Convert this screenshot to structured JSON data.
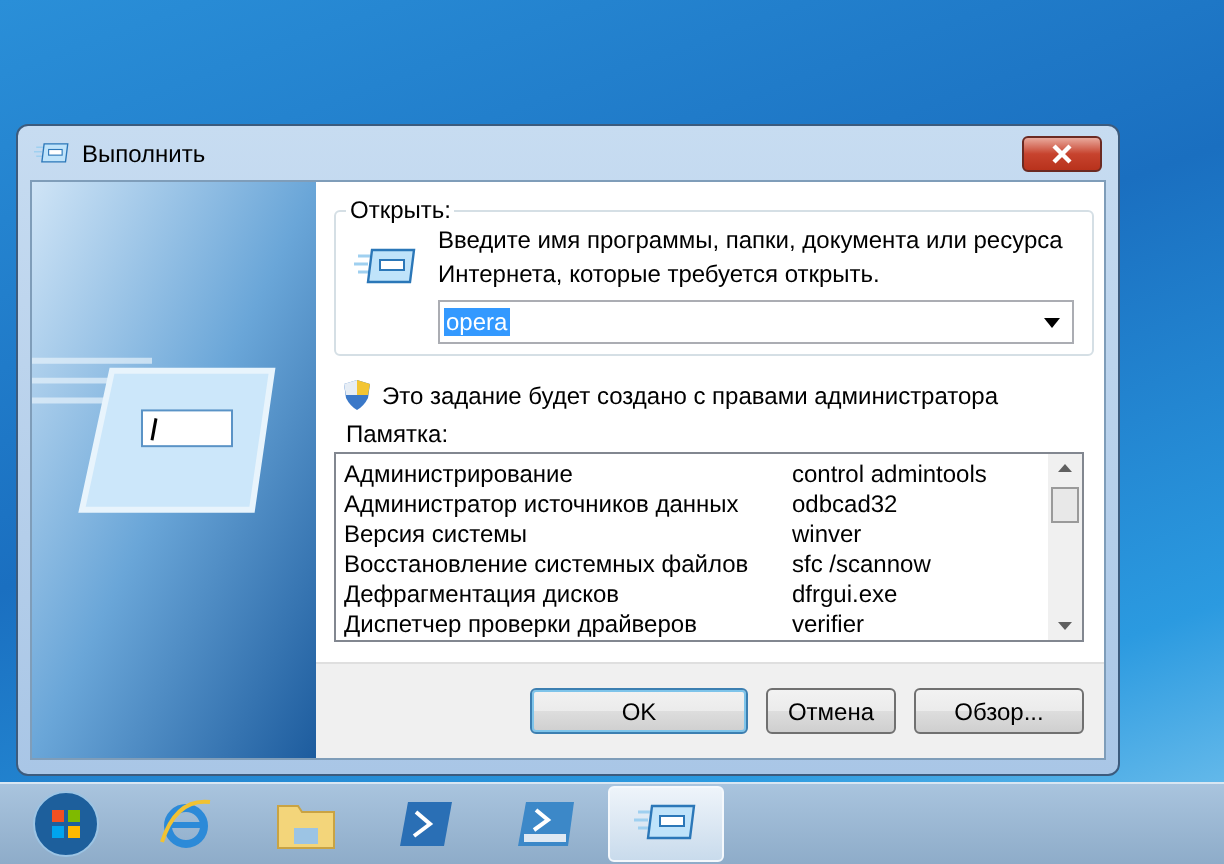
{
  "window": {
    "title": "Выполнить"
  },
  "open_group": {
    "label": "Открыть:",
    "description": "Введите имя программы, папки, документа или ресурса Интернета, которые требуется открыть.",
    "input": {
      "value": "opera",
      "selected": true
    }
  },
  "admin_note": "Это задание будет создано с правами администратора",
  "memo": {
    "label": "Памятка:",
    "rows": [
      {
        "name": "Администрирование",
        "command": "control admintools"
      },
      {
        "name": "Администратор источников данных",
        "command": "odbcad32"
      },
      {
        "name": "Версия системы",
        "command": "winver"
      },
      {
        "name": "Восстановление системных файлов",
        "command": "sfc /scannow"
      },
      {
        "name": "Дефрагментация дисков",
        "command": "dfrgui.exe"
      },
      {
        "name": "Диспетчер проверки драйверов",
        "command": "verifier"
      }
    ]
  },
  "buttons": [
    {
      "label": "OK",
      "default": true
    },
    {
      "label": "Отмена",
      "default": false
    },
    {
      "label": "Обзор...",
      "default": false
    }
  ],
  "taskbar": [
    {
      "kind": "start",
      "selected": false
    },
    {
      "kind": "browser",
      "selected": false
    },
    {
      "kind": "folder",
      "selected": false
    },
    {
      "kind": "shell",
      "selected": false
    },
    {
      "kind": "shell-ise",
      "selected": false
    },
    {
      "kind": "run",
      "selected": true
    }
  ]
}
